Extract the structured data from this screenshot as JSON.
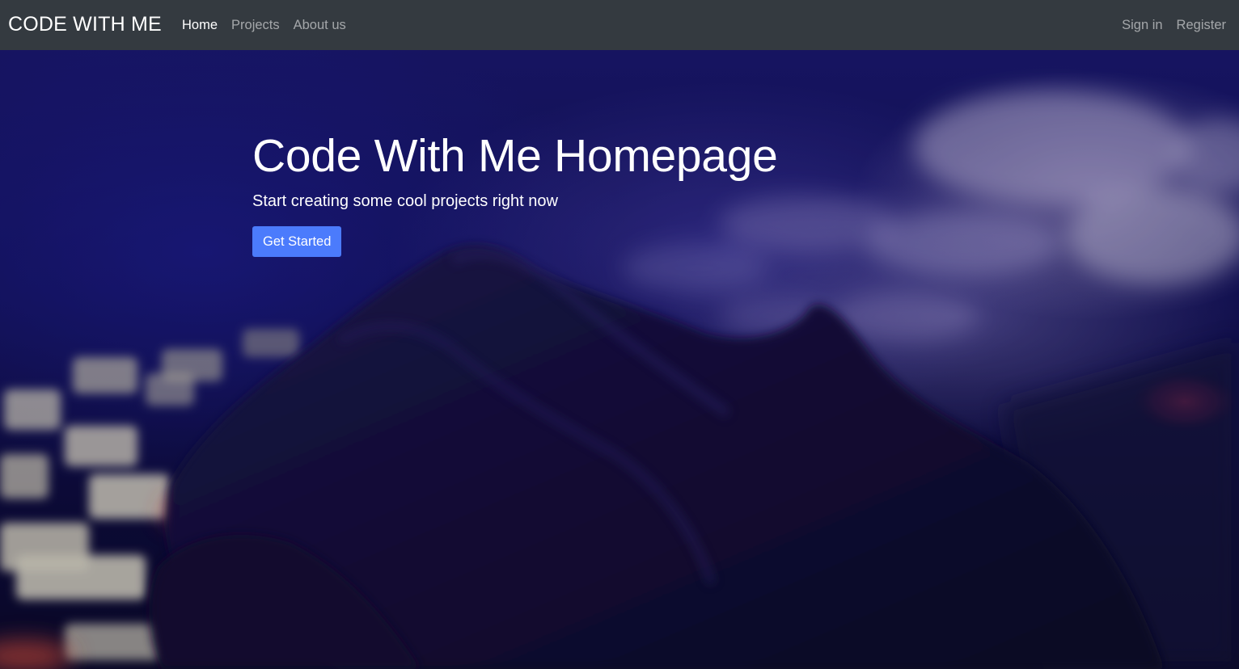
{
  "navbar": {
    "brand": "CODE WITH ME",
    "left_links": [
      {
        "label": "Home",
        "active": true
      },
      {
        "label": "Projects",
        "active": false
      },
      {
        "label": "About us",
        "active": false
      }
    ],
    "right_links": [
      {
        "label": "Sign in"
      },
      {
        "label": "Register"
      }
    ]
  },
  "hero": {
    "title": "Code With Me Homepage",
    "subtitle": "Start creating some cool projects right now",
    "cta_label": "Get Started",
    "background_image": "hand-on-keyboard-photo"
  },
  "colors": {
    "navbar_bg": "#343a40",
    "nav_link": "rgba(255,255,255,0.55)",
    "nav_link_active": "#ffffff",
    "cta_bg": "#4b7bfc",
    "hero_tint": "#14125a"
  }
}
